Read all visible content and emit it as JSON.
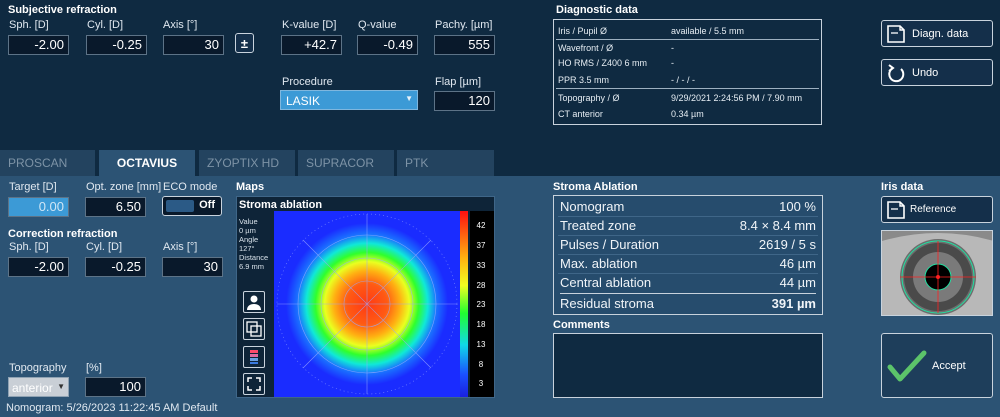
{
  "subjective": {
    "title": "Subjective refraction",
    "sph_label": "Sph. [D]",
    "sph_value": "-2.00",
    "cyl_label": "Cyl. [D]",
    "cyl_value": "-0.25",
    "axis_label": "Axis [°]",
    "axis_value": "30",
    "toggle_symbol": "±",
    "k_label": "K-value [D]",
    "k_value": "+42.7",
    "q_label": "Q-value",
    "q_value": "-0.49",
    "pachy_label": "Pachy. [µm]",
    "pachy_value": "555",
    "procedure_label": "Procedure",
    "procedure_value": "LASIK",
    "flap_label": "Flap [µm]",
    "flap_value": "120"
  },
  "diagnostic": {
    "title": "Diagnostic data",
    "rows": [
      {
        "label": "Iris / Pupil Ø",
        "value": "available / 5.5 mm"
      },
      {
        "label": "Wavefront / Ø",
        "value": "-"
      },
      {
        "label": "HO RMS / Z400 6 mm",
        "value": "-"
      },
      {
        "label": "PPR 3.5 mm",
        "value": "- / - / -"
      },
      {
        "label": "Topography / Ø",
        "value": "9/29/2021 2:24:56 PM / 7.90 mm"
      },
      {
        "label": "CT anterior",
        "value": "0.34 µm"
      }
    ]
  },
  "buttons": {
    "diagn": "Diagn. data",
    "undo": "Undo",
    "reference": "Reference",
    "accept": "Accept"
  },
  "tabs": [
    "PROSCAN",
    "OCTAVIUS",
    "ZYOPTIX HD",
    "SUPRACOR",
    "PTK"
  ],
  "octavius": {
    "target_label": "Target [D]",
    "target_value": "0.00",
    "optzone_label": "Opt. zone [mm]",
    "optzone_value": "6.50",
    "eco_label": "ECO mode",
    "eco_value": "Off",
    "correction_title": "Correction refraction",
    "sph_label": "Sph. [D]",
    "sph_value": "-2.00",
    "cyl_label": "Cyl. [D]",
    "cyl_value": "-0.25",
    "axis_label": "Axis [°]",
    "axis_value": "30",
    "topo_label": "Topography",
    "topo_value": "anterior",
    "pct_label": "[%]",
    "pct_value": "100",
    "nomogram_footer": "Nomogram: 5/26/2023 11:22:45 AM Default"
  },
  "maps": {
    "title": "Maps",
    "map_title": "Stroma ablation",
    "info": [
      "Value",
      "0 µm",
      "Angle",
      "127°",
      "Distance",
      "6.9 mm"
    ],
    "scale": [
      "42",
      "37",
      "33",
      "28",
      "23",
      "18",
      "13",
      "8",
      "3"
    ]
  },
  "stroma": {
    "title": "Stroma Ablation",
    "rows": [
      {
        "label": "Nomogram",
        "value": "100 %"
      },
      {
        "label": "Treated zone",
        "value": "8.4 × 8.4 mm"
      },
      {
        "label": "Pulses / Duration",
        "value": "2619 / 5 s"
      },
      {
        "label": "Max. ablation",
        "value": "46 µm"
      },
      {
        "label": "Central ablation",
        "value": "44 µm"
      }
    ],
    "residual_label": "Residual stroma",
    "residual_value": "391 µm",
    "comments_label": "Comments"
  },
  "iris": {
    "title": "Iris data"
  }
}
